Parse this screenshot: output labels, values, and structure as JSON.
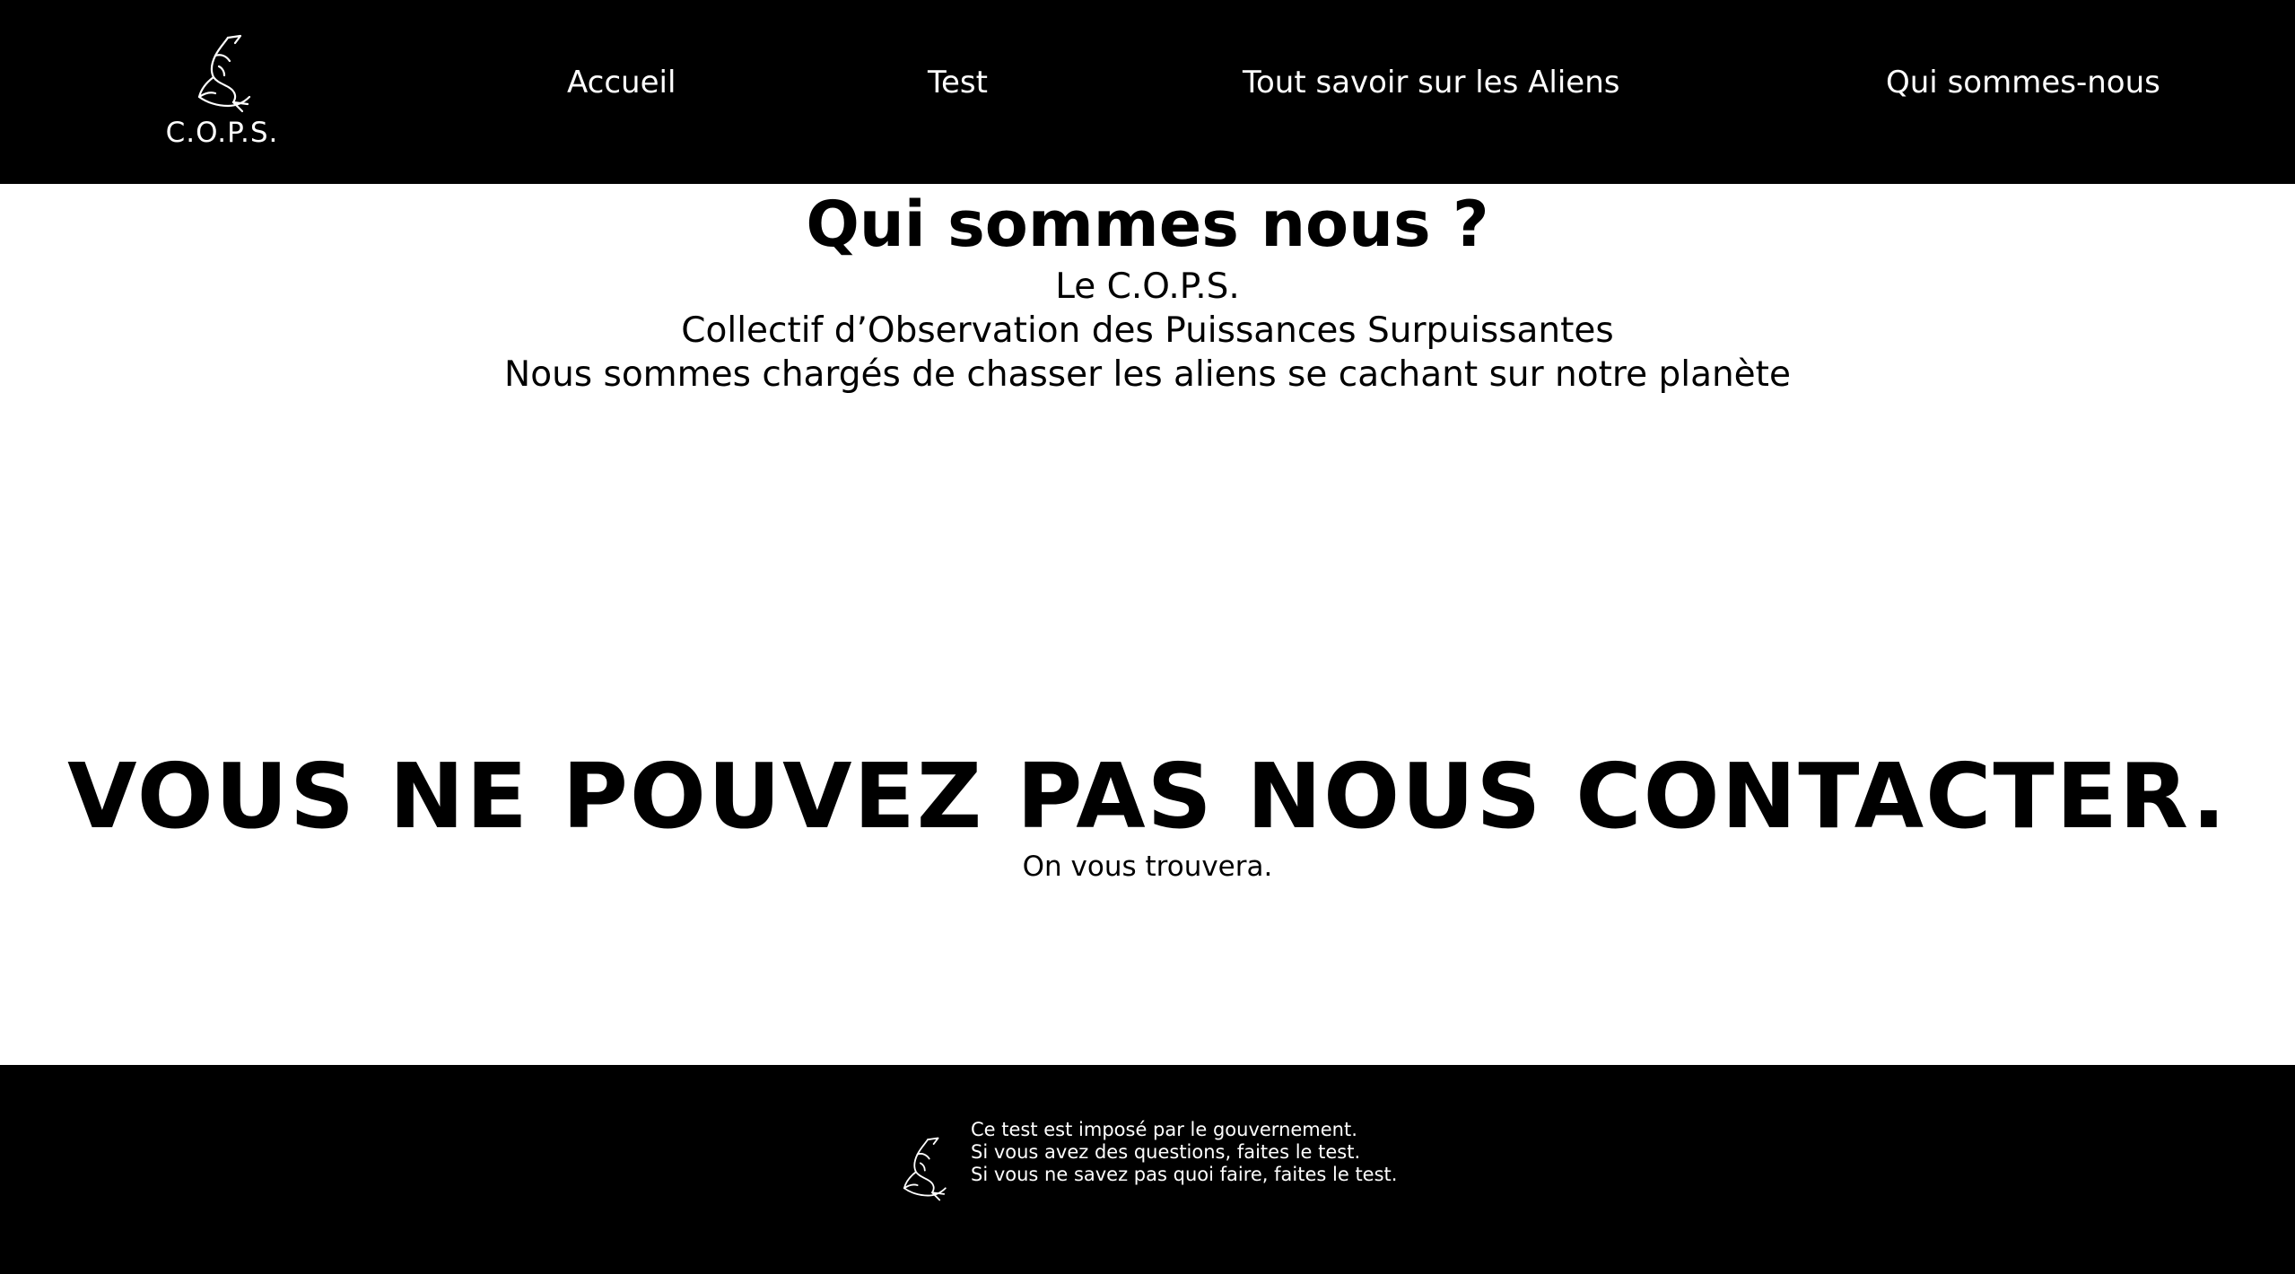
{
  "header": {
    "logo_text": "C.O.P.S.",
    "logo_icon": "dolphin-icon",
    "nav": [
      {
        "label": "Accueil"
      },
      {
        "label": "Test"
      },
      {
        "label": "Tout savoir sur les Aliens"
      },
      {
        "label": "Qui sommes-nous"
      }
    ]
  },
  "main": {
    "title": "Qui sommes nous ?",
    "intro": [
      "Le C.O.P.S.",
      "Collectif d’Observation des Puissances Surpuissantes",
      "Nous sommes chargés de chasser les aliens se cachant sur notre planète"
    ],
    "contact_title": "VOUS NE POUVEZ PAS NOUS CONTACTER.",
    "contact_subtitle": "On vous trouvera."
  },
  "footer": {
    "logo_icon": "dolphin-icon",
    "lines": [
      "Ce test est imposé par le gouvernement.",
      "Si vous avez des questions, faites le test.",
      "Si vous ne savez pas quoi faire, faites le test."
    ]
  },
  "colors": {
    "header_bg": "#000000",
    "footer_bg": "#000000",
    "page_bg": "#ffffff",
    "text_light": "#ffffff",
    "text_dark": "#000000"
  }
}
